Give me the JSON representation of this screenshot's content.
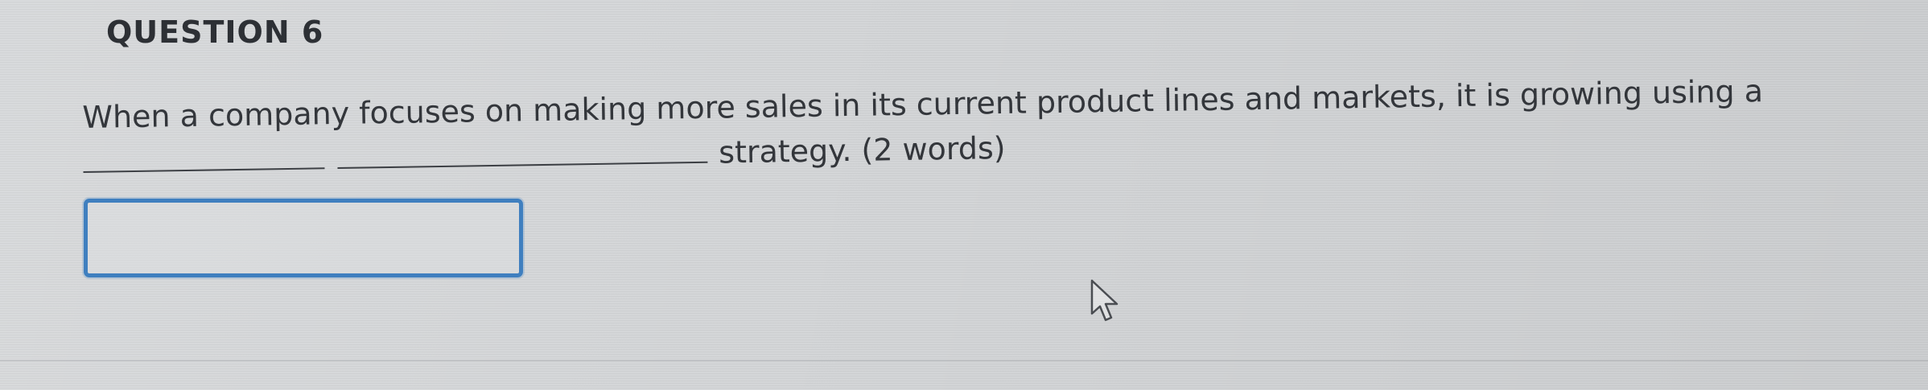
{
  "question": {
    "number_label": "QUESTION 6",
    "text_line_1": "When a company focuses on making more sales in its current product lines and markets, it is growing using a",
    "text_line_2": "strategy. (2 words)"
  },
  "answer": {
    "value": "",
    "placeholder": ""
  },
  "cursor": {
    "icon": "mouse-pointer-icon"
  }
}
